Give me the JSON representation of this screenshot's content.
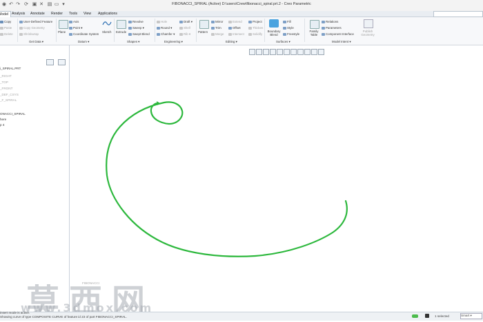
{
  "window": {
    "title": "FIBONACCI_SPIRAL (Active) D:\\users\\Crew\\fibonacci_spiral.prt.2 - Creo Parametric"
  },
  "menu": {
    "tabs": [
      "Model",
      "Analysis",
      "Annotate",
      "Render",
      "Tools",
      "View",
      "Applications"
    ],
    "active": "Model"
  },
  "ribbon": {
    "operations": {
      "copy": "Copy",
      "paste": "Paste",
      "delete": "Delete"
    },
    "get_data": {
      "user_defined_feature": "User-Defined Feature",
      "copy_geometry": "Copy Geometry",
      "shrinkwrap": "Shrinkwrap",
      "label": "Get Data"
    },
    "datum": {
      "plane": "Plane",
      "axis": "Axis",
      "point": "Point",
      "coordinate_system": "Coordinate System",
      "sketch": "Sketch",
      "label": "Datum"
    },
    "shapes": {
      "extrude": "Extrude",
      "revolve": "Revolve",
      "sweep": "Sweep",
      "swept_blend": "Swept Blend",
      "label": "Shapes"
    },
    "engineering": {
      "hole": "Hole",
      "round": "Round",
      "chamfer": "Chamfer",
      "draft": "Draft",
      "shell": "Shell",
      "rib": "Rib",
      "label": "Engineering"
    },
    "editing": {
      "pattern": "Pattern",
      "mirror": "Mirror",
      "trim": "Trim",
      "merge": "Merge",
      "extend": "Extend",
      "offset": "Offset",
      "intersect": "Intersect",
      "project": "Project",
      "thicken": "Thicken",
      "solidify": "Solidify",
      "label": "Editing"
    },
    "surfaces": {
      "boundary_blend": "Boundary Blend",
      "fill": "Fill",
      "style": "Style",
      "freestyle": "Freestyle",
      "label": "Surfaces"
    },
    "model_intent": {
      "family_table": "Family Table",
      "relations": "Relations",
      "parameters": "Parameters",
      "component_interface": "Component Interface",
      "publish_geometry": "Publish Geometry",
      "label": "Model Intent"
    }
  },
  "model_tree": {
    "items": [
      {
        "text": "i_SPIRAL.PRT",
        "dim": false
      },
      {
        "text": "_RIGHT",
        "dim": true
      },
      {
        "text": "_TOP",
        "dim": true
      },
      {
        "text": "_FRONT",
        "dim": true
      },
      {
        "text": "_DEF_CSYS",
        "dim": true
      },
      {
        "text": "_F_SPIRAL",
        "dim": true
      },
      {
        "text": "ONACCI_SPIRAL",
        "dim": false
      },
      {
        "text": "here",
        "dim": false
      },
      {
        "text": "p 4",
        "dim": false
      }
    ]
  },
  "status": {
    "message_1": "insert mode is active.",
    "message_2": "Showing curve of type COMPOSITE CURVE of feature id 23 of part FIBONACCI_SPIRAL.",
    "selected": "1 selected",
    "filter": "Smart"
  },
  "watermark": {
    "text": "莫西网",
    "url": "www.3dmox.com"
  },
  "canvas": {
    "curve_color": "#2db83d",
    "label": "FIBONACCI"
  },
  "chart_data": null
}
